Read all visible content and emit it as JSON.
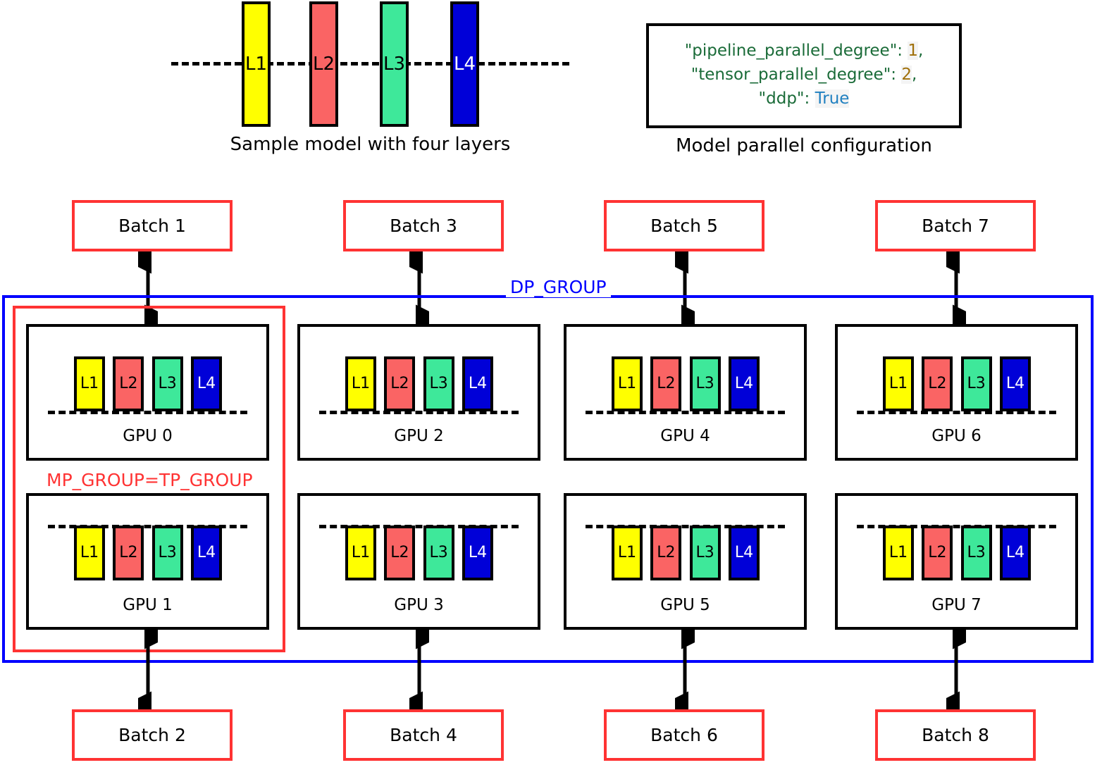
{
  "sample_model": {
    "caption": "Sample model with four layers",
    "layers": [
      {
        "label": "L1",
        "color": "#FFFF00",
        "text_color": "#000000"
      },
      {
        "label": "L2",
        "color": "#FA6464",
        "text_color": "#000000"
      },
      {
        "label": "L3",
        "color": "#3EE89A",
        "text_color": "#000000"
      },
      {
        "label": "L4",
        "color": "#0000D8",
        "text_color": "#FFFFFF"
      }
    ]
  },
  "config": {
    "caption": "Model parallel configuration",
    "lines": [
      {
        "key": "\"pipeline_parallel_degree\"",
        "sep": ": ",
        "value": "1",
        "value_type": "number",
        "trailing": ","
      },
      {
        "key": "\"tensor_parallel_degree\"",
        "sep": ": ",
        "value": "2",
        "value_type": "number",
        "trailing": ","
      },
      {
        "key": "\"ddp\"",
        "sep": ": ",
        "value": "True",
        "value_type": "bool",
        "trailing": ""
      }
    ],
    "colors": {
      "key": "#1A6B38",
      "number": "#A0700A",
      "bool": "#2080C0",
      "highlight": "#F4F4F4"
    }
  },
  "groups": {
    "dp_label": "DP_GROUP",
    "dp_color": "#0000FF",
    "mp_label": "MP_GROUP=TP_GROUP",
    "mp_color": "#FF3333"
  },
  "batches": {
    "top": [
      "Batch 1",
      "Batch 3",
      "Batch 5",
      "Batch 7"
    ],
    "bottom": [
      "Batch 2",
      "Batch 4",
      "Batch 6",
      "Batch 8"
    ],
    "border_color": "#FF3333"
  },
  "gpus": {
    "top_row": [
      "GPU 0",
      "GPU 2",
      "GPU 4",
      "GPU 6"
    ],
    "bottom_row": [
      "GPU 1",
      "GPU 3",
      "GPU 5",
      "GPU 7"
    ],
    "layer_labels": [
      "L1",
      "L2",
      "L3",
      "L4"
    ],
    "top_row_split": "layers-above-dashed-line",
    "bottom_row_split": "layers-below-dashed-line"
  }
}
